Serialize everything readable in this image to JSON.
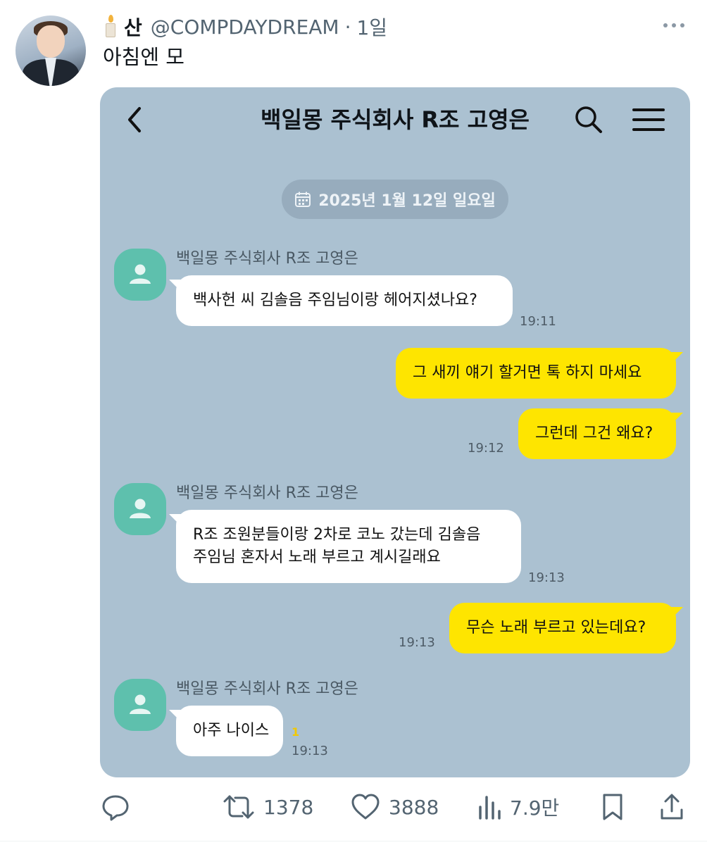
{
  "tweet": {
    "display_name": "산",
    "handle": "@COMPDAYDREAM",
    "separator": "·",
    "time": "1일",
    "text": "아침엔 모"
  },
  "chat": {
    "title": "백일몽 주식회사 R조 고영은",
    "date": "2025년 1월 12일 일요일",
    "messages": [
      {
        "sender": "백일몽 주식회사 R조 고영은",
        "lines": [
          "백사헌 씨 김솔음 주임님이랑 헤어지셨나요?"
        ],
        "time": "19:11"
      },
      {
        "lines": [
          "그 새끼 얘기 할거면 톡 하지 마세요"
        ]
      },
      {
        "lines": [
          "그런데 그건 왜요?"
        ],
        "time": "19:12"
      },
      {
        "sender": "백일몽 주식회사 R조 고영은",
        "lines": [
          "R조 조원분들이랑 2차로 코노 갔는데 김솔음",
          "주임님 혼자서 노래 부르고 계시길래요"
        ],
        "time": "19:13"
      },
      {
        "lines": [
          "무슨 노래 부르고 있는데요?"
        ],
        "time": "19:13"
      },
      {
        "sender": "백일몽 주식회사 R조 고영은",
        "lines": [
          "아주 나이스"
        ],
        "time": "19:13",
        "unread": "1"
      }
    ]
  },
  "actions": {
    "retweets": "1378",
    "likes": "3888",
    "views": "7.9만"
  },
  "colors": {
    "chat_bg": "#abc1d1",
    "outgoing_bubble": "#fee500",
    "incoming_bubble": "#ffffff",
    "profile_pic": "#5ec0ad",
    "muted_text": "#536471"
  }
}
